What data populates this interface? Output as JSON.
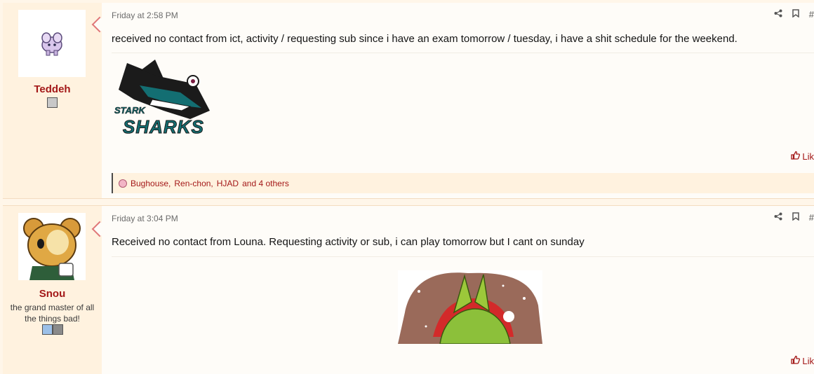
{
  "posts": [
    {
      "username": "Teddeh",
      "user_title": "",
      "timestamp": "Friday at 2:58 PM",
      "post_number": "#",
      "message": "received no contact from ict, activity / requesting sub since i have an exam tomorrow / tuesday, i have a shit schedule for the weekend.",
      "image_text_top": "STARK",
      "image_text_bottom": "SHARKS",
      "like_label": "Lik",
      "reactions": {
        "users": [
          "Bughouse",
          "Ren-chon",
          "HJAD"
        ],
        "others_text": "and 4 others"
      }
    },
    {
      "username": "Snou",
      "user_title": "the grand master of all the things bad!",
      "timestamp": "Friday at 3:04 PM",
      "post_number": "#",
      "message": "Received no contact from Louna. Requesting activity or sub, i can play tomorrow but I cant on sunday",
      "like_label": "Lik"
    }
  ],
  "colors": {
    "accent": "#a31818",
    "page_bg": "#fff6e9",
    "post_bg": "#fefcf8",
    "user_panel_bg": "#fff2df"
  },
  "icons": [
    "share-icon",
    "bookmark-icon",
    "thumbs-up-icon"
  ]
}
